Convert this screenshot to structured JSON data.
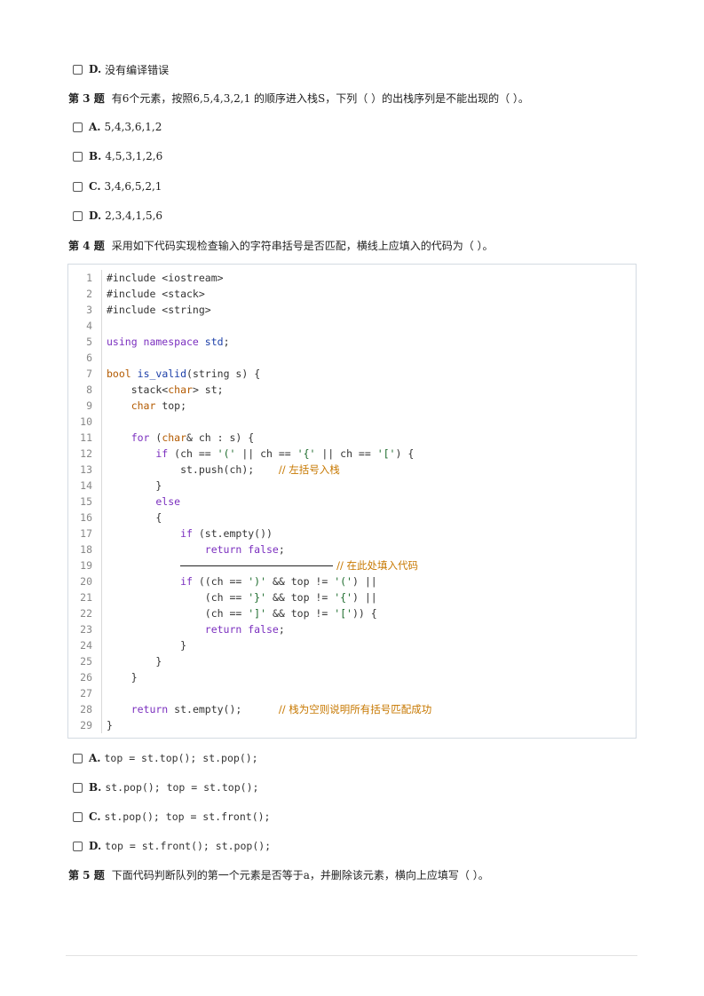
{
  "prev_option": {
    "letter": "D.",
    "text": "没有编译错误"
  },
  "q3": {
    "num": "第 3 题",
    "text": "有6个元素，按照6,5,4,3,2,1 的顺序进入栈S，下列（ ）的出栈序列是不能出现的（ ）。",
    "options": [
      {
        "letter": "A.",
        "text": "5,4,3,6,1,2"
      },
      {
        "letter": "B.",
        "text": "4,5,3,1,2,6"
      },
      {
        "letter": "C.",
        "text": "3,4,6,5,2,1"
      },
      {
        "letter": "D.",
        "text": "2,3,4,1,5,6"
      }
    ]
  },
  "q4": {
    "num": "第 4 题",
    "text": "采用如下代码实现检查输入的字符串括号是否匹配，横线上应填入的代码为（ ）。",
    "code_lines": [
      {
        "n": "1",
        "segs": [
          {
            "c": "",
            "t": "#include <iostream>"
          }
        ]
      },
      {
        "n": "2",
        "segs": [
          {
            "c": "",
            "t": "#include <stack>"
          }
        ]
      },
      {
        "n": "3",
        "segs": [
          {
            "c": "",
            "t": "#include <string>"
          }
        ]
      },
      {
        "n": "4",
        "segs": []
      },
      {
        "n": "5",
        "segs": [
          {
            "c": "kw",
            "t": "using namespace"
          },
          {
            "c": "",
            "t": " "
          },
          {
            "c": "fn",
            "t": "std"
          },
          {
            "c": "",
            "t": ";"
          }
        ]
      },
      {
        "n": "6",
        "segs": []
      },
      {
        "n": "7",
        "segs": [
          {
            "c": "ty",
            "t": "bool"
          },
          {
            "c": "",
            "t": " "
          },
          {
            "c": "fn",
            "t": "is_valid"
          },
          {
            "c": "",
            "t": "(string s) {"
          }
        ]
      },
      {
        "n": "8",
        "segs": [
          {
            "c": "",
            "t": "    stack<"
          },
          {
            "c": "ty",
            "t": "char"
          },
          {
            "c": "",
            "t": "> st;"
          }
        ]
      },
      {
        "n": "9",
        "segs": [
          {
            "c": "ty",
            "t": "    char"
          },
          {
            "c": "",
            "t": " top;"
          }
        ]
      },
      {
        "n": "10",
        "segs": []
      },
      {
        "n": "11",
        "segs": [
          {
            "c": "kw",
            "t": "    for"
          },
          {
            "c": "",
            "t": " ("
          },
          {
            "c": "ty",
            "t": "char"
          },
          {
            "c": "",
            "t": "& ch : s) {"
          }
        ]
      },
      {
        "n": "12",
        "segs": [
          {
            "c": "kw",
            "t": "        if"
          },
          {
            "c": "",
            "t": " (ch == "
          },
          {
            "c": "str",
            "t": "'('"
          },
          {
            "c": "",
            "t": " || ch == "
          },
          {
            "c": "str",
            "t": "'{'"
          },
          {
            "c": "",
            "t": " || ch == "
          },
          {
            "c": "str",
            "t": "'['"
          },
          {
            "c": "",
            "t": ") {"
          }
        ]
      },
      {
        "n": "13",
        "segs": [
          {
            "c": "",
            "t": "            st.push(ch);    "
          },
          {
            "c": "cm",
            "t": "// 左括号入栈"
          }
        ]
      },
      {
        "n": "14",
        "segs": [
          {
            "c": "",
            "t": "        }"
          }
        ]
      },
      {
        "n": "15",
        "segs": [
          {
            "c": "kw",
            "t": "        else"
          }
        ]
      },
      {
        "n": "16",
        "segs": [
          {
            "c": "",
            "t": "        {"
          }
        ]
      },
      {
        "n": "17",
        "segs": [
          {
            "c": "kw",
            "t": "            if"
          },
          {
            "c": "",
            "t": " (st.empty())"
          }
        ]
      },
      {
        "n": "18",
        "segs": [
          {
            "c": "kw",
            "t": "                return false"
          },
          {
            "c": "",
            "t": ";"
          }
        ]
      },
      {
        "n": "19",
        "segs": [
          {
            "c": "",
            "t": "            "
          },
          {
            "c": "blank",
            "t": ""
          },
          {
            "c": "cm",
            "t": "// 在此处填入代码"
          }
        ]
      },
      {
        "n": "20",
        "segs": [
          {
            "c": "kw",
            "t": "            if"
          },
          {
            "c": "",
            "t": " ((ch == "
          },
          {
            "c": "str",
            "t": "')'"
          },
          {
            "c": "",
            "t": " && top != "
          },
          {
            "c": "str",
            "t": "'('"
          },
          {
            "c": "",
            "t": ") ||"
          }
        ]
      },
      {
        "n": "21",
        "segs": [
          {
            "c": "",
            "t": "                (ch == "
          },
          {
            "c": "str",
            "t": "'}'"
          },
          {
            "c": "",
            "t": " && top != "
          },
          {
            "c": "str",
            "t": "'{'"
          },
          {
            "c": "",
            "t": ") ||"
          }
        ]
      },
      {
        "n": "22",
        "segs": [
          {
            "c": "",
            "t": "                (ch == "
          },
          {
            "c": "str",
            "t": "']'"
          },
          {
            "c": "",
            "t": " && top != "
          },
          {
            "c": "str",
            "t": "'['"
          },
          {
            "c": "",
            "t": ")) {"
          }
        ]
      },
      {
        "n": "23",
        "segs": [
          {
            "c": "kw",
            "t": "                return false"
          },
          {
            "c": "",
            "t": ";"
          }
        ]
      },
      {
        "n": "24",
        "segs": [
          {
            "c": "",
            "t": "            }"
          }
        ]
      },
      {
        "n": "25",
        "segs": [
          {
            "c": "",
            "t": "        }"
          }
        ]
      },
      {
        "n": "26",
        "segs": [
          {
            "c": "",
            "t": "    }"
          }
        ]
      },
      {
        "n": "27",
        "segs": []
      },
      {
        "n": "28",
        "segs": [
          {
            "c": "kw",
            "t": "    return"
          },
          {
            "c": "",
            "t": " st.empty();      "
          },
          {
            "c": "cm",
            "t": "// 栈为空则说明所有括号匹配成功"
          }
        ]
      },
      {
        "n": "29",
        "segs": [
          {
            "c": "",
            "t": "}"
          }
        ]
      }
    ],
    "options": [
      {
        "letter": "A.",
        "text": "top = st.top(); st.pop();"
      },
      {
        "letter": "B.",
        "text": "st.pop(); top = st.top();"
      },
      {
        "letter": "C.",
        "text": "st.pop(); top = st.front();"
      },
      {
        "letter": "D.",
        "text": "top = st.front();  st.pop();"
      }
    ]
  },
  "q5": {
    "num": "第 5 题",
    "text": "下面代码判断队列的第一个元素是否等于a，并删除该元素，横向上应填写（ ）。"
  }
}
